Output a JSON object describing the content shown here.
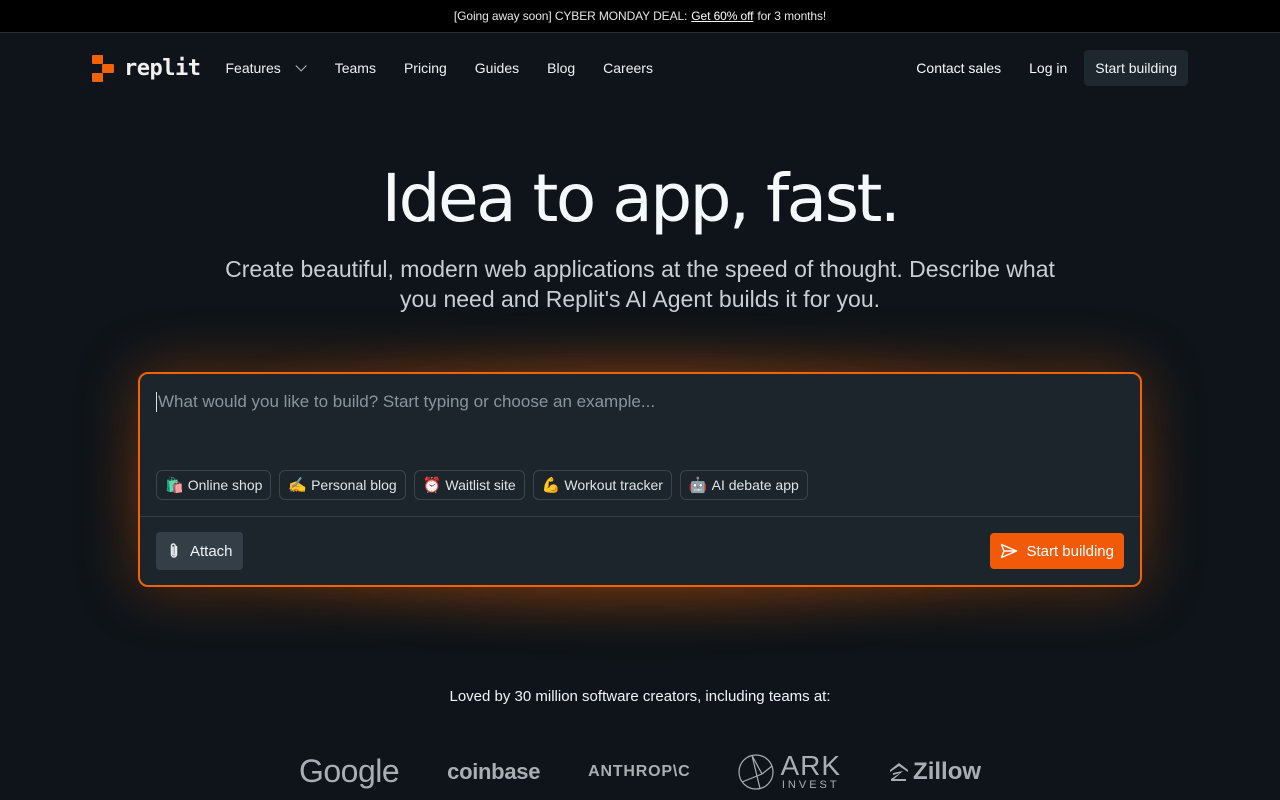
{
  "promo": {
    "prefix": "[Going away soon] CYBER MONDAY DEAL:",
    "link": "Get 60% off",
    "suffix": "for 3 months!"
  },
  "nav": {
    "logo_text": "replit",
    "links": [
      "Features",
      "Teams",
      "Pricing",
      "Guides",
      "Blog",
      "Careers"
    ],
    "contact": "Contact sales",
    "login": "Log in",
    "cta": "Start building"
  },
  "hero": {
    "title": "Idea to app, fast.",
    "subtitle": "Create beautiful, modern web applications at the speed of thought. Describe what you need and Replit's AI Agent builds it for you."
  },
  "prompt": {
    "placeholder": "What would you like to build? Start typing or choose an example...",
    "value": "",
    "chips": [
      {
        "emoji": "🛍️",
        "label": "Online shop"
      },
      {
        "emoji": "✍️",
        "label": "Personal blog"
      },
      {
        "emoji": "⏰",
        "label": "Waitlist site"
      },
      {
        "emoji": "💪",
        "label": "Workout tracker"
      },
      {
        "emoji": "🤖",
        "label": "AI debate app"
      }
    ],
    "attach_label": "Attach",
    "start_label": "Start building"
  },
  "social": {
    "loved_text": "Loved by 30 million software creators, including teams at:",
    "brands": [
      "Google",
      "coinbase",
      "ANTHROP\\C",
      "ARK",
      "INVEST",
      "Zillow"
    ]
  },
  "colors": {
    "accent": "#f26207",
    "background": "#0e1419",
    "panel": "#1c252c"
  }
}
